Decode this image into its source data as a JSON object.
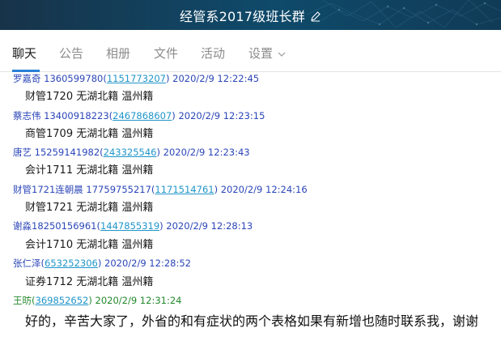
{
  "window": {
    "title": "经管系2017级班长群"
  },
  "tabs": [
    {
      "label": "聊天"
    },
    {
      "label": "公告"
    },
    {
      "label": "相册"
    },
    {
      "label": "文件"
    },
    {
      "label": "活动"
    },
    {
      "label": "设置"
    }
  ],
  "messages": [
    {
      "sender": "罗嘉奇 1360599780(",
      "qq": "1151773207",
      "time": ") 2020/2/9 12:22:45",
      "text": "财管1720  无湖北籍 温州籍"
    },
    {
      "sender": "蔡志伟   13400918223(",
      "qq": "2467868607",
      "time": ") 2020/2/9 12:23:15",
      "text": "商管1709  无湖北籍 温州籍"
    },
    {
      "sender": "唐艺 15259141982(",
      "qq": "243325546",
      "time": ") 2020/2/9 12:23:43",
      "text": "会计1711 无湖北籍 温州籍"
    },
    {
      "sender": " 财管1721连朝晨  17759755217(",
      "qq": "1171514761",
      "time": ") 2020/2/9 12:24:16",
      "text": "财管1721  无湖北籍 温州籍"
    },
    {
      "sender": "谢淼18250156961(",
      "qq": "1447855319",
      "time": ") 2020/2/9 12:28:13",
      "text": "会计1710  无湖北籍 温州籍"
    },
    {
      "sender": "张仁泽(",
      "qq": "653252306",
      "time": ") 2020/2/9 12:28:52",
      "text": "证券1712 无湖北籍 温州籍"
    },
    {
      "sender": "王昉(",
      "qq": "369852652",
      "time": ") 2020/2/9 12:31:24",
      "text": "好的，辛苦大家了，外省的和有症状的两个表格如果有新增也随时联系我，谢谢"
    }
  ],
  "colors": {
    "titlebar": "#12425f",
    "tab_active_underline": "#2a7fd6",
    "sender_blue": "#2b46b8",
    "sender_green": "#24892c",
    "qq_link": "#1f95c9"
  },
  "icons": {
    "title_edit": "pencil-icon",
    "settings_dropdown": "chevron-down-icon"
  }
}
